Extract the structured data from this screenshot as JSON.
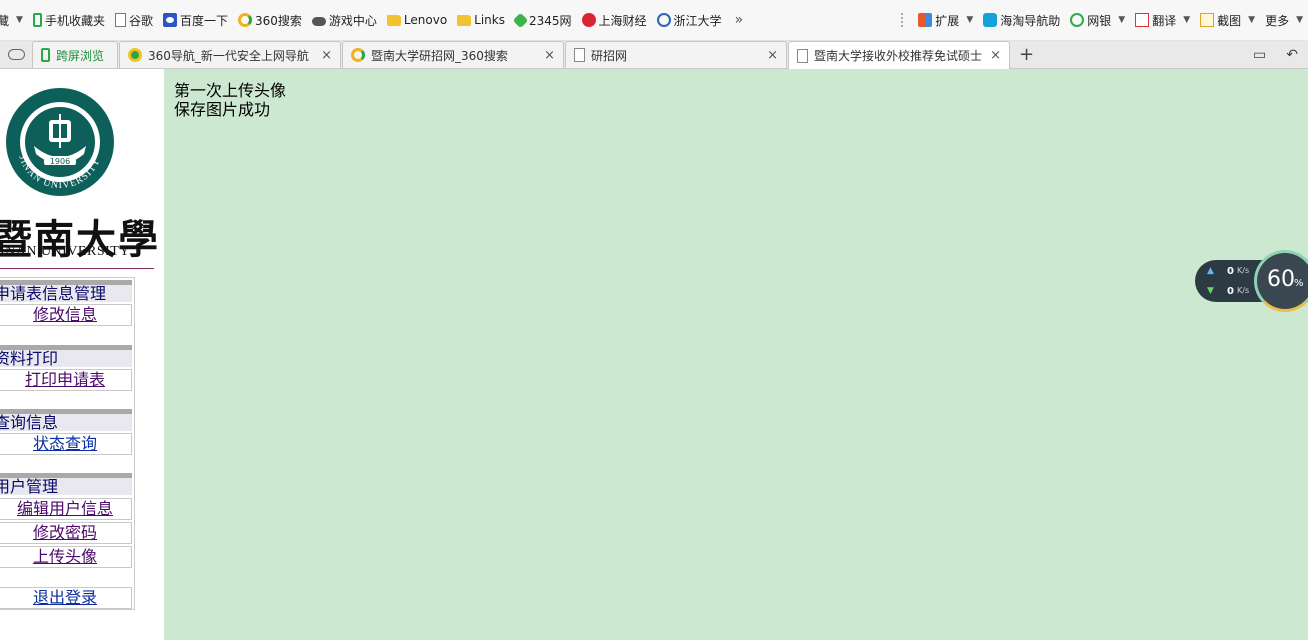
{
  "bookmarks": {
    "items": [
      {
        "label": "藏",
        "icon": "none"
      },
      {
        "label": "手机收藏夹",
        "icon": "phone-icon"
      },
      {
        "label": "谷歌",
        "icon": "page-icon"
      },
      {
        "label": "百度一下",
        "icon": "baidu-paw-icon"
      },
      {
        "label": "360搜索",
        "icon": "360-search-icon"
      },
      {
        "label": "游戏中心",
        "icon": "gamepad-icon"
      },
      {
        "label": "Lenovo",
        "icon": "folder-icon"
      },
      {
        "label": "Links",
        "icon": "folder-icon"
      },
      {
        "label": "2345网",
        "icon": "2345-icon"
      },
      {
        "label": "上海财经",
        "icon": "sufe-icon"
      },
      {
        "label": "浙江大学",
        "icon": "zju-icon"
      }
    ],
    "more_chevron": "»",
    "right_items": [
      {
        "label": "扩展",
        "icon": "extensions-icon"
      },
      {
        "label": "海淘导航助",
        "icon": "shopping-icon"
      },
      {
        "label": "网银",
        "icon": "yen-icon"
      },
      {
        "label": "翻译",
        "icon": "translate-icon"
      },
      {
        "label": "截图",
        "icon": "screenshot-icon"
      },
      {
        "label": "更多",
        "icon": "none"
      }
    ]
  },
  "tabs": [
    {
      "label": "跨屏浏览",
      "icon": "phone-icon",
      "closable": false
    },
    {
      "label": "360导航_新一代安全上网导航",
      "icon": "360-nav-icon",
      "closable": true
    },
    {
      "label": "暨南大学研招网_360搜索",
      "icon": "360-search-icon",
      "closable": true
    },
    {
      "label": "研招网",
      "icon": "page-icon",
      "closable": true
    },
    {
      "label": "暨南大学接收外校推荐免试硕士",
      "icon": "page-icon",
      "closable": true,
      "active": true
    }
  ],
  "tab_close_glyph": "×",
  "new_tab_glyph": "+",
  "logo": {
    "chinese": "暨南大學",
    "english": "JINAN UNIVERSITY",
    "emblem_text": "JINAN UNIVERSITY",
    "emblem_year": "1906"
  },
  "menu": {
    "groups": [
      {
        "title": "申请表信息管理",
        "links": [
          "修改信息"
        ]
      },
      {
        "title": "资料打印",
        "links": [
          "打印申请表"
        ]
      },
      {
        "title": "查询信息",
        "links": [
          "状态查询"
        ]
      },
      {
        "title": "用户管理",
        "links": [
          "编辑用户信息",
          "修改密码",
          "上传头像"
        ]
      }
    ],
    "logout": "退出登录"
  },
  "main": {
    "line1": "第一次上传头像",
    "line2": "保存图片成功"
  },
  "speed_widget": {
    "up_value": "0",
    "up_unit": "K/s",
    "down_value": "0",
    "down_unit": "K/s",
    "percent": "60",
    "percent_sign": "%"
  }
}
